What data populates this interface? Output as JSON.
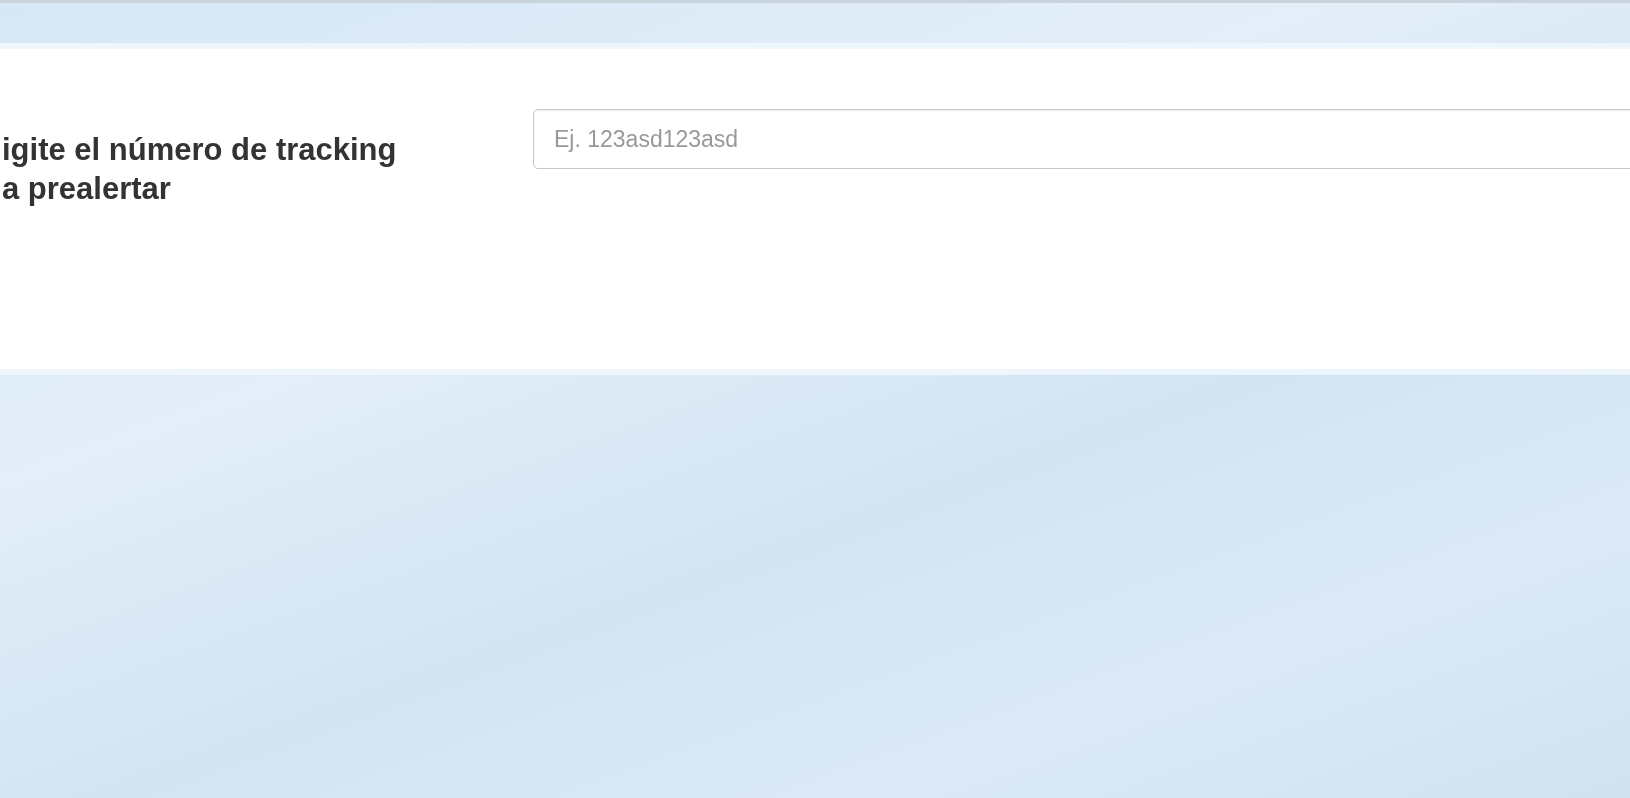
{
  "form": {
    "label": "igite el número de tracking\na prealertar",
    "tracking_field": {
      "placeholder": "Ej. 123asd123asd"
    }
  }
}
